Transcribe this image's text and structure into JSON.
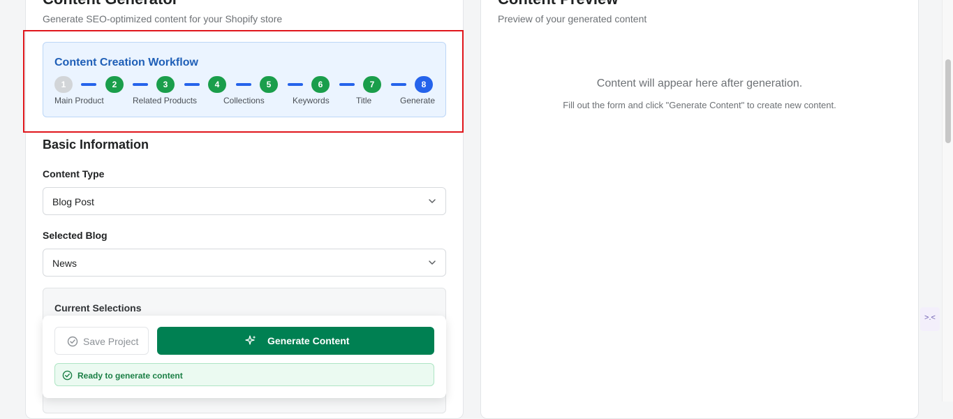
{
  "left_panel": {
    "title": "Content Generator",
    "subtitle": "Generate SEO-optimized content for your Shopify store"
  },
  "workflow": {
    "title": "Content Creation Workflow",
    "steps": [
      {
        "number": "1",
        "label": "Main Product",
        "state": "disabled"
      },
      {
        "number": "2",
        "label": "Related Products",
        "state": "done"
      },
      {
        "number": "3",
        "label": "",
        "state": "done"
      },
      {
        "number": "4",
        "label": "Collections",
        "state": "done"
      },
      {
        "number": "5",
        "label": "",
        "state": "done"
      },
      {
        "number": "6",
        "label": "Keywords",
        "state": "done"
      },
      {
        "number": "7",
        "label": "Title",
        "state": "done"
      },
      {
        "number": "8",
        "label": "Generate",
        "state": "active"
      }
    ]
  },
  "basic_info": {
    "title": "Basic Information",
    "content_type_label": "Content Type",
    "content_type_value": "Blog Post",
    "blog_label": "Selected Blog",
    "blog_value": "News"
  },
  "selections": {
    "title": "Current Selections"
  },
  "actions": {
    "save_label": "Save Project",
    "generate_label": "Generate Content",
    "status_text": "Ready to generate content"
  },
  "preview": {
    "title": "Content Preview",
    "subtitle": "Preview of your generated content",
    "empty_text": "Content will appear here after generation.",
    "hint_text": "Fill out the form and click \"Generate Content\" to create new content."
  },
  "side_widget": {
    "icon": "collapse-arrows-icon",
    "text": ">.<"
  },
  "colors": {
    "step_done": "#1a9e4b",
    "step_active": "#2563eb",
    "step_disabled": "#d2d5d8",
    "primary_button": "#008052",
    "highlight_border": "#e0161c"
  }
}
